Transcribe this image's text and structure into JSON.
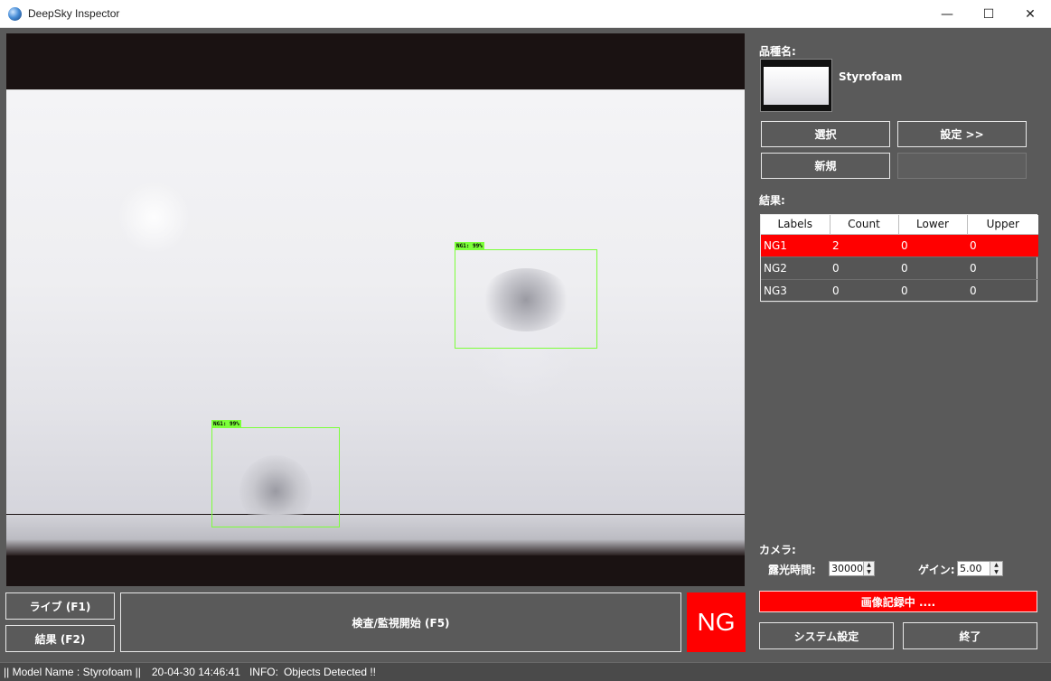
{
  "window": {
    "title": "DeepSky Inspector",
    "minimize_glyph": "—",
    "maximize_glyph": "☐",
    "close_glyph": "✕"
  },
  "camera_view": {
    "detections": [
      {
        "label": "NG1: 99%"
      },
      {
        "label": "NG1: 99%"
      }
    ]
  },
  "product": {
    "section_label": "品種名:",
    "name": "Styrofoam",
    "select_button": "選択",
    "settings_button": "設定 >>",
    "new_button": "新規"
  },
  "results": {
    "section_label": "結果:",
    "columns": [
      "Labels",
      "Count",
      "Lower",
      "Upper"
    ],
    "rows": [
      {
        "label": "NG1",
        "count": "2",
        "lower": "0",
        "upper": "0",
        "status": "ng"
      },
      {
        "label": "NG2",
        "count": "0",
        "lower": "0",
        "upper": "0",
        "status": "ok"
      },
      {
        "label": "NG3",
        "count": "0",
        "lower": "0",
        "upper": "0",
        "status": "ok"
      }
    ]
  },
  "camera": {
    "section_label": "カメラ:",
    "exposure_label": "露光時間:",
    "exposure_value": "30000",
    "gain_label": "ゲイン:",
    "gain_value": "5.00"
  },
  "recording_status": "画像記録中 ....",
  "controls": {
    "live_button": "ライブ (F1)",
    "result_button": "結果 (F2)",
    "start_button": "検査/監視開始 (F5)",
    "judgement": "NG",
    "system_settings_button": "システム設定",
    "exit_button": "終了"
  },
  "statusbar": {
    "model": "|| Model Name : Styrofoam ||",
    "timestamp": "20-04-30 14:46:41",
    "info_label": "INFO:",
    "info_message": "Objects Detected !!"
  },
  "colors": {
    "ng_red": "#ff0000",
    "detection_green": "#7cff3a",
    "panel_gray": "#5a5a5a"
  }
}
